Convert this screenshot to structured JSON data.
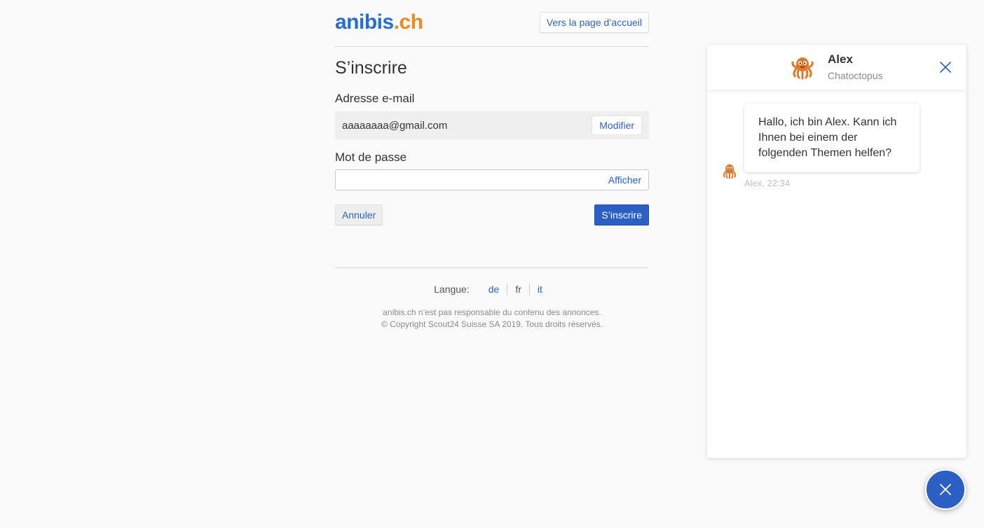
{
  "header": {
    "logo_part1": "anibis",
    "logo_part2": ".ch",
    "home_link": "Vers la page d’accueil"
  },
  "form": {
    "title": "S’inscrire",
    "email_label": "Adresse e-mail",
    "email_value": "aaaaaaaa@gmail.com",
    "modify_label": "Modifier",
    "password_label": "Mot de passe",
    "password_value": "",
    "show_label": "Afficher",
    "cancel_label": "Annuler",
    "submit_label": "S’inscrire"
  },
  "footer": {
    "language_label": "Langue:",
    "languages": [
      "de",
      "fr",
      "it"
    ],
    "disclaimer": "anibis.ch n’est pas responsable du contenu des annonces.",
    "copyright": "© Copyright Scout24 Suisse SA 2019. Tous droits réservés."
  },
  "chat": {
    "agent_name": "Alex",
    "agent_subtitle": "Chatoctopus",
    "message": "Hallo, ich bin Alex. Kann ich Ihnen bei einem der folgenden Themen helfen?",
    "message_meta": "Alex, 22:34"
  },
  "colors": {
    "brand_blue": "#2a6ccd",
    "brand_orange": "#ee8a22",
    "link_blue": "#2a62c9",
    "button_blue": "#2b5fc4"
  }
}
